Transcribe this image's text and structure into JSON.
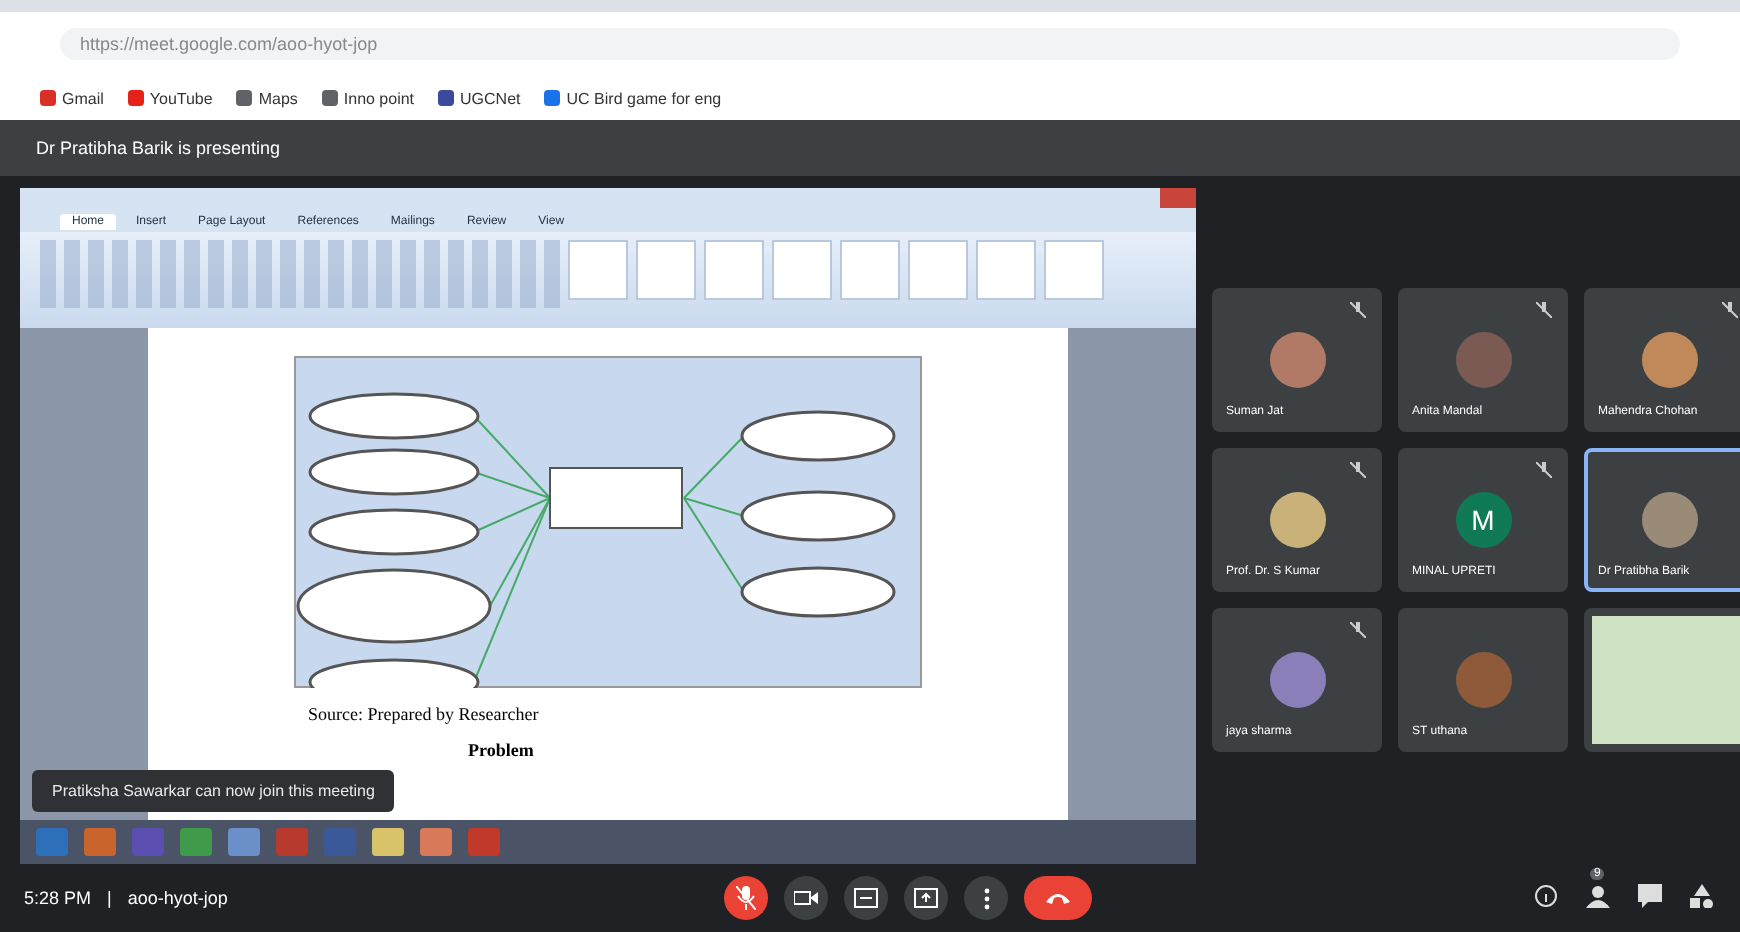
{
  "browser": {
    "url": "https://meet.google.com/aoo-hyot-jop",
    "bookmarks": [
      {
        "label": "Gmail",
        "color": "#d93025"
      },
      {
        "label": "YouTube",
        "color": "#e62117"
      },
      {
        "label": "Maps",
        "color": "#5f6368"
      },
      {
        "label": "Inno point",
        "color": "#5f6368"
      },
      {
        "label": "UGCNet",
        "color": "#3c4a9e"
      },
      {
        "label": "UC Bird game for eng",
        "color": "#1a73e8"
      }
    ]
  },
  "presenting_bar": {
    "text": "Dr Pratibha Barik is presenting"
  },
  "shared_screen": {
    "ribbon_tabs": [
      {
        "label": "Home",
        "selected": true
      },
      {
        "label": "Insert",
        "selected": false
      },
      {
        "label": "Page Layout",
        "selected": false
      },
      {
        "label": "References",
        "selected": false
      },
      {
        "label": "Mailings",
        "selected": false
      },
      {
        "label": "Review",
        "selected": false
      },
      {
        "label": "View",
        "selected": false
      }
    ],
    "caption": "Source: Prepared by Researcher",
    "next_heading": "Problem",
    "taskbar_apps": [
      {
        "color": "#2d6fb8"
      },
      {
        "color": "#c8642c"
      },
      {
        "color": "#5a4fb0"
      },
      {
        "color": "#3f9a4a"
      },
      {
        "color": "#6b8fc8"
      },
      {
        "color": "#b83a2f"
      },
      {
        "color": "#3b5998"
      },
      {
        "color": "#d9c36a"
      },
      {
        "color": "#d87a5a"
      },
      {
        "color": "#c0392b"
      }
    ]
  },
  "toast": {
    "text": "Pratiksha Sawarkar can now join this meeting"
  },
  "participants": [
    {
      "name": "Suman Jat",
      "kind": "avatar",
      "color": "#b07a66",
      "muted": true,
      "selected": false
    },
    {
      "name": "Anita Mandal",
      "kind": "avatar",
      "color": "#7a5a52",
      "muted": true,
      "selected": false
    },
    {
      "name": "Mahendra Chohan",
      "kind": "avatar",
      "color": "#c0895a",
      "muted": true,
      "selected": false
    },
    {
      "name": "Prof. Dr. S Kumar",
      "kind": "avatar",
      "color": "#c9b27a",
      "muted": true,
      "selected": false
    },
    {
      "name": "MINAL UPRETI",
      "kind": "initial",
      "initial": "M",
      "color": "#0f7a55",
      "muted": true,
      "selected": false
    },
    {
      "name": "Dr Pratibha Barik",
      "kind": "avatar",
      "color": "#9a8a78",
      "muted": false,
      "selected": true
    },
    {
      "name": "jaya sharma",
      "kind": "avatar",
      "color": "#8a7fb8",
      "muted": true,
      "selected": false
    },
    {
      "name": "ST uthana",
      "kind": "avatar",
      "color": "#8f5a3a",
      "muted": false,
      "selected": false
    },
    {
      "kind": "screen",
      "selected": false
    }
  ],
  "bottom_bar": {
    "time": "5:28 PM",
    "separator": "|",
    "meeting_code": "aoo-hyot-jop",
    "controls": [
      {
        "kind": "mic",
        "muted": true
      },
      {
        "kind": "camera"
      },
      {
        "kind": "captions"
      },
      {
        "kind": "present"
      },
      {
        "kind": "more"
      },
      {
        "kind": "hangup"
      }
    ],
    "right_icons": [
      {
        "kind": "info"
      },
      {
        "kind": "people",
        "badge": "9"
      },
      {
        "kind": "chat"
      },
      {
        "kind": "activities"
      }
    ]
  }
}
